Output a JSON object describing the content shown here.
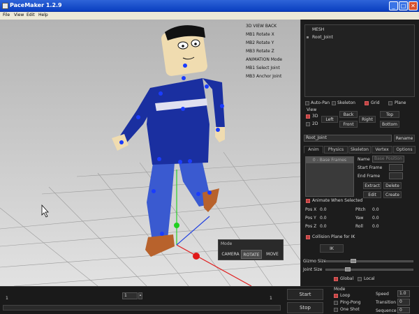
{
  "window": {
    "title": "PaceMaker 1.2.9",
    "min": "_",
    "max": "□",
    "close": "✕"
  },
  "menu": [
    "File",
    "View",
    "Edit",
    "Help"
  ],
  "viewport": {
    "help": [
      "3D VIEW BACK",
      "MB1 Rotate X",
      "MB2 Rotate Y",
      "MB3 Rotate Z",
      "ANIMATION Mode",
      "MB1 Select Joint",
      "MB3 Anchor Joint"
    ]
  },
  "mode_box": {
    "title": "Mode",
    "buttons": [
      "CAMERA",
      "ROTATE",
      "MOVE"
    ],
    "active": "ROTATE"
  },
  "tree": {
    "root": "MESH",
    "child": "Root_Joint"
  },
  "display": {
    "auto_pan": "Auto-Pan",
    "skeleton": "Skeleton",
    "grid": "Grid",
    "plane": "Plane"
  },
  "view": {
    "label": "View",
    "opt_3d": "3D",
    "opt_2d": "2D",
    "left": "Left",
    "back": "Back",
    "front": "Front",
    "right": "Right",
    "top": "Top",
    "bottom": "Bottom"
  },
  "joint": {
    "name": "Root_Joint",
    "rename": "Rename"
  },
  "tabs": [
    "Anim",
    "Physics",
    "Skeleton",
    "Vertex",
    "Options"
  ],
  "anim": {
    "list_header": "0 - Base Frames",
    "name_label": "Name",
    "name_placeholder": "Base Position",
    "start_label": "Start Frame",
    "end_label": "End Frame",
    "extract": "Extract",
    "delete": "Delete",
    "edit": "Edit",
    "create": "Create",
    "animate_when_selected": "Animate When Selected"
  },
  "transform": {
    "pos_x": "Pos X",
    "pos_x_val": "0.0",
    "pos_y": "Pos Y",
    "pos_y_val": "0.0",
    "pos_z": "Pos Z",
    "pos_z_val": "0.0",
    "pitch": "Pitch",
    "pitch_val": "0.0",
    "yaw": "Yaw",
    "yaw_val": "0.0",
    "roll": "Roll",
    "roll_val": "0.0"
  },
  "ik": {
    "collision": "Collision Plane for IK",
    "button": "IK"
  },
  "gizmo": {
    "gizmo_size": "Gizmo Size",
    "joint_size": "Joint Size",
    "global": "Global",
    "local": "Local"
  },
  "timeline": {
    "left_num": "1",
    "frame_value": "1",
    "right_num": "1"
  },
  "playback": {
    "start": "Start",
    "stop": "Stop"
  },
  "mode": {
    "label": "Mode",
    "loop": "Loop",
    "pingpong": "Ping-Pong",
    "oneshot": "One Shot"
  },
  "speed": {
    "speed_label": "Speed",
    "speed_val": "1.0",
    "transition_label": "Transition",
    "transition_val": "0",
    "sequence_label": "Sequence",
    "sequence_val": "0"
  },
  "colors": {
    "body": "#1a2fa0",
    "legs": "#3a5ad0",
    "shoe": "#b8622c",
    "skin": "#f0dcb0",
    "joint": "#1a3cff",
    "active_check": "#c04040"
  }
}
